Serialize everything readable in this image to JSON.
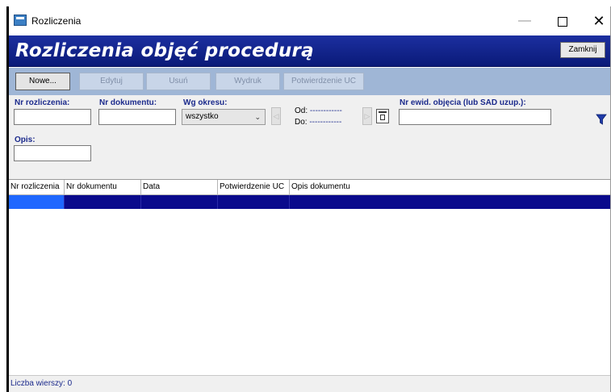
{
  "window": {
    "title": "Rozliczenia",
    "min_glyph": "—",
    "close_glyph": "✕"
  },
  "header": {
    "title": "Rozliczenia objęć procedurą",
    "close_label": "Zamknij"
  },
  "toolbar": {
    "new_label": "Nowe...",
    "edit_label": "Edytuj",
    "delete_label": "Usuń",
    "print_label": "Wydruk",
    "uc_label": "Potwierdzenie UC"
  },
  "filters": {
    "nr_rozliczenia_label": "Nr rozliczenia:",
    "nr_rozliczenia_value": "",
    "nr_dokumentu_label": "Nr dokumentu:",
    "nr_dokumentu_value": "",
    "okres_label": "Wg okresu:",
    "okres_value": "wszystko",
    "od_label": "Od:",
    "od_value": "------------",
    "do_label": "Do:",
    "do_value": "------------",
    "nr_ewid_label": "Nr ewid. objęcia (lub SAD uzup.):",
    "nr_ewid_value": "",
    "opis_label": "Opis:",
    "opis_value": "",
    "prev_glyph": "◁",
    "next_glyph": "▷"
  },
  "table": {
    "columns": [
      "Nr rozliczenia",
      "Nr dokumentu",
      "Data",
      "Potwierdzenie UC",
      "Opis dokumentu"
    ]
  },
  "status": {
    "rows_label": "Liczba wierszy: 0"
  },
  "colors": {
    "header_blue": "#0a1a78",
    "toolbar_blue": "#9fb6d6",
    "selected_row": "#0a0a8c",
    "label_blue": "#1b2a8c",
    "filter_icon": "#1e3aa8"
  },
  "icons": {
    "app": "app-window-icon",
    "calendar": "calendar-icon",
    "filter": "funnel-icon",
    "dropdown": "chevron-down-icon"
  }
}
